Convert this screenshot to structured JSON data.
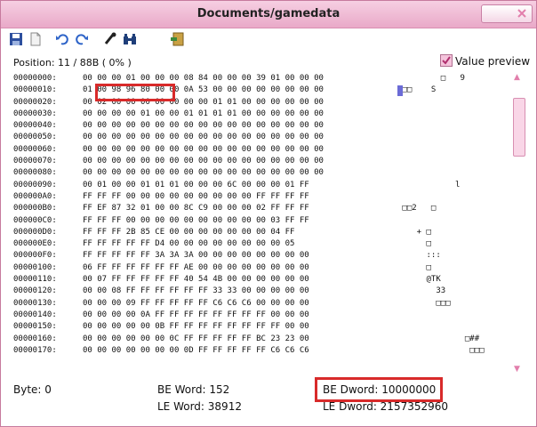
{
  "window": {
    "title": "Documents/gamedata"
  },
  "toolbar": {
    "items": [
      "save-icon",
      "new-file-icon",
      "undo-icon",
      "redo-icon",
      "tool-icon",
      "binoculars-icon",
      "exit-icon"
    ]
  },
  "position_label": "Position: 11 / 88B ( 0% )",
  "value_preview": {
    "label": "Value preview",
    "checked": true
  },
  "hex_rows": [
    {
      "addr": "00000000:",
      "bytes": "00 00 00 01 00 00 00 08 84 00 00 00 39 01 00 00 00",
      "ascii": "         □   9"
    },
    {
      "addr": "00000010:",
      "bytes": "01 00 98 96 80 00 00 0A 53 00 00 00 00 00 00 00 00",
      "ascii": " □□    S"
    },
    {
      "addr": "00000020:",
      "bytes": "00 02 00 00 00 00 00 00 00 01 01 00 00 00 00 00 00",
      "ascii": ""
    },
    {
      "addr": "00000030:",
      "bytes": "00 00 00 00 01 00 00 01 01 01 01 00 00 00 00 00 00",
      "ascii": ""
    },
    {
      "addr": "00000040:",
      "bytes": "00 00 00 00 00 00 00 00 00 00 00 00 00 00 00 00 00",
      "ascii": ""
    },
    {
      "addr": "00000050:",
      "bytes": "00 00 00 00 00 00 00 00 00 00 00 00 00 00 00 00 00",
      "ascii": ""
    },
    {
      "addr": "00000060:",
      "bytes": "00 00 00 00 00 00 00 00 00 00 00 00 00 00 00 00 00",
      "ascii": ""
    },
    {
      "addr": "00000070:",
      "bytes": "00 00 00 00 00 00 00 00 00 00 00 00 00 00 00 00 00",
      "ascii": ""
    },
    {
      "addr": "00000080:",
      "bytes": "00 00 00 00 00 00 00 00 00 00 00 00 00 00 00 00 00",
      "ascii": ""
    },
    {
      "addr": "00000090:",
      "bytes": "00 01 00 00 01 01 01 00 00 00 6C 00 00 00 01 FF",
      "ascii": "            l"
    },
    {
      "addr": "000000A0:",
      "bytes": "FF FF FF 00 00 00 00 00 00 00 00 00 FF FF FF FF",
      "ascii": ""
    },
    {
      "addr": "000000B0:",
      "bytes": "FF EF 87 32 01 00 00 8C C9 00 00 00 02 FF FF FF",
      "ascii": " □□2   □"
    },
    {
      "addr": "000000C0:",
      "bytes": "FF FF FF 00 00 00 00 00 00 00 00 00 00 03 FF FF",
      "ascii": ""
    },
    {
      "addr": "000000D0:",
      "bytes": "FF FF FF 2B 85 CE 00 00 00 00 00 00 00 04 FF",
      "ascii": "    + □"
    },
    {
      "addr": "000000E0:",
      "bytes": "FF FF FF FF FF D4 00 00 00 00 00 00 00 00 05",
      "ascii": "      □"
    },
    {
      "addr": "000000F0:",
      "bytes": "FF FF FF FF FF 3A 3A 3A 00 00 00 00 00 00 00 00",
      "ascii": "      :::"
    },
    {
      "addr": "00000100:",
      "bytes": "06 FF FF FF FF FF FF AE 00 00 00 00 00 00 00 00",
      "ascii": "      □"
    },
    {
      "addr": "00000110:",
      "bytes": "00 07 FF FF FF FF FF 40 54 4B 00 00 00 00 00 00",
      "ascii": "      @TK"
    },
    {
      "addr": "00000120:",
      "bytes": "00 00 08 FF FF FF FF FF FF 33 33 00 00 00 00 00",
      "ascii": "        33"
    },
    {
      "addr": "00000130:",
      "bytes": "00 00 00 09 FF FF FF FF FF C6 C6 C6 00 00 00 00",
      "ascii": "        □□□"
    },
    {
      "addr": "00000140:",
      "bytes": "00 00 00 00 0A FF FF FF FF FF FF FF FF 00 00 00",
      "ascii": ""
    },
    {
      "addr": "00000150:",
      "bytes": "00 00 00 00 00 0B FF FF FF FF FF FF FF FF 00 00",
      "ascii": ""
    },
    {
      "addr": "00000160:",
      "bytes": "00 00 00 00 00 00 0C FF FF FF FF FF BC 23 23 00",
      "ascii": "              □##"
    },
    {
      "addr": "00000170:",
      "bytes": "00 00 00 00 00 00 00 0D FF FF FF FF FF C6 C6 C6",
      "ascii": "               □□□"
    }
  ],
  "footer": {
    "byte_label": "Byte: 0",
    "be_word_label": "BE Word: 152",
    "le_word_label": "LE Word: 38912",
    "be_dword_label": "BE Dword: 10000000",
    "le_dword_label": "LE Dword: 2157352960"
  },
  "colors": {
    "accent": "#e9a9c8",
    "selection": "#6b6bd6",
    "annotation": "#d82a2a"
  }
}
